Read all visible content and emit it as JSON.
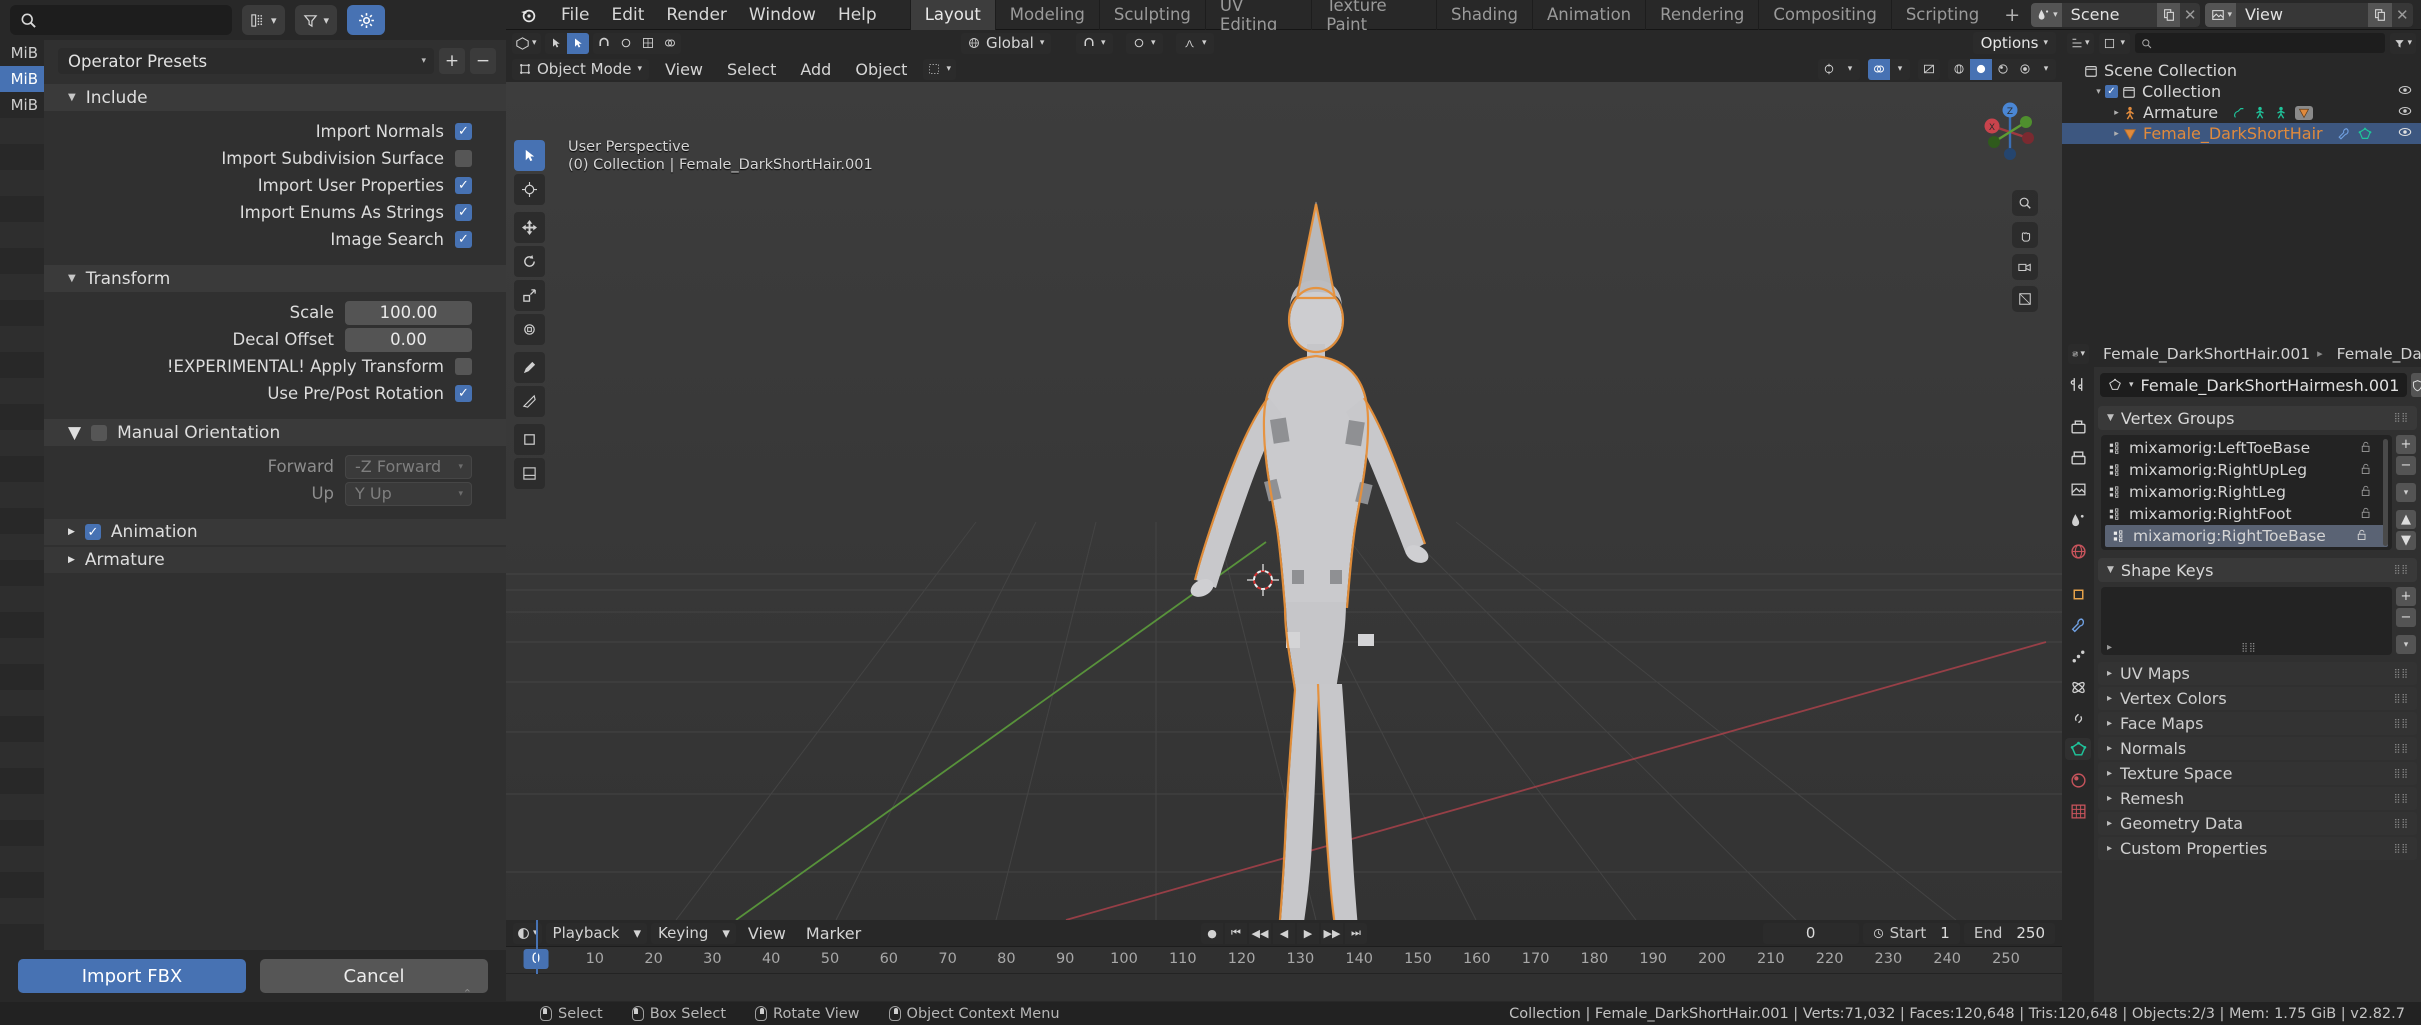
{
  "app": {
    "title": "Blender",
    "version": "v2.82.7"
  },
  "topbar": {
    "menus": [
      "File",
      "Edit",
      "Render",
      "Window",
      "Help"
    ],
    "workspaces": [
      {
        "label": "Layout",
        "active": true
      },
      {
        "label": "Modeling",
        "active": false
      },
      {
        "label": "Sculpting",
        "active": false
      },
      {
        "label": "UV Editing",
        "active": false
      },
      {
        "label": "Texture Paint",
        "active": false
      },
      {
        "label": "Shading",
        "active": false
      },
      {
        "label": "Animation",
        "active": false
      },
      {
        "label": "Rendering",
        "active": false
      },
      {
        "label": "Compositing",
        "active": false
      },
      {
        "label": "Scripting",
        "active": false
      }
    ],
    "add_workspace": "+",
    "scene_name": "Scene",
    "view_layer_name": "View Layer"
  },
  "viewport": {
    "mode": "Object Mode",
    "menus": [
      "View",
      "Select",
      "Add",
      "Object"
    ],
    "transform_orientation": "Global",
    "options_label": "Options",
    "overlay_line1": "User Perspective",
    "overlay_line2": "(0) Collection | Female_DarkShortHair.001",
    "gizmo_axes": [
      "X",
      "Y",
      "Z"
    ]
  },
  "timeline": {
    "menus": [
      "Playback",
      "Keying",
      "View",
      "Marker"
    ],
    "current_frame": "0",
    "start_label": "Start",
    "start_value": "1",
    "end_label": "End",
    "end_value": "250",
    "frame_field": "0",
    "ticks": [
      "0",
      "10",
      "20",
      "30",
      "40",
      "50",
      "60",
      "70",
      "80",
      "90",
      "100",
      "110",
      "120",
      "130",
      "140",
      "150",
      "160",
      "170",
      "180",
      "190",
      "200",
      "210",
      "220",
      "230",
      "240",
      "250"
    ]
  },
  "outliner": {
    "search_placeholder": "",
    "rows": [
      {
        "label": "Scene Collection",
        "indent": 0,
        "type": "scene-collection",
        "selected": false
      },
      {
        "label": "Collection",
        "indent": 1,
        "type": "collection",
        "selected": false
      },
      {
        "label": "Armature",
        "indent": 2,
        "type": "armature",
        "selected": false
      },
      {
        "label": "Female_DarkShortHair",
        "indent": 2,
        "type": "mesh",
        "selected": true
      }
    ]
  },
  "properties": {
    "breadcrumb_object": "Female_DarkShortHair.001",
    "breadcrumb_data": "Female_Da",
    "mesh_datablock": "Female_DarkShortHairmesh.001",
    "vertex_groups_title": "Vertex Groups",
    "vertex_groups": [
      {
        "name": "mixamorig:LeftToeBase",
        "selected": false
      },
      {
        "name": "mixamorig:RightUpLeg",
        "selected": false
      },
      {
        "name": "mixamorig:RightLeg",
        "selected": false
      },
      {
        "name": "mixamorig:RightFoot",
        "selected": false
      },
      {
        "name": "mixamorig:RightToeBase",
        "selected": true
      }
    ],
    "shape_keys_title": "Shape Keys",
    "collapsed_panels": [
      "UV Maps",
      "Vertex Colors",
      "Face Maps",
      "Normals",
      "Texture Space",
      "Remesh",
      "Geometry Data",
      "Custom Properties"
    ]
  },
  "import_dialog": {
    "search_value": "",
    "presets_label": "Operator Presets",
    "add_preset": "+",
    "remove_preset": "−",
    "sidebar_sizes": [
      "MiB",
      "MiB",
      "MiB"
    ],
    "sections": {
      "include": {
        "title": "Include",
        "rows": [
          {
            "label": "Import Normals",
            "checked": true
          },
          {
            "label": "Import Subdivision Surface",
            "checked": false
          },
          {
            "label": "Import User Properties",
            "checked": true
          },
          {
            "label": "Import Enums As Strings",
            "checked": true
          },
          {
            "label": "Image Search",
            "checked": true
          }
        ]
      },
      "transform": {
        "title": "Transform",
        "scale_label": "Scale",
        "scale_value": "100.00",
        "decal_label": "Decal Offset",
        "decal_value": "0.00",
        "apply_transform_label": "!EXPERIMENTAL! Apply Transform",
        "apply_transform_checked": false,
        "prepost_label": "Use Pre/Post Rotation",
        "prepost_checked": true
      },
      "manual_orientation": {
        "title": "Manual Orientation",
        "enabled": false,
        "forward_label": "Forward",
        "forward_value": "-Z Forward",
        "up_label": "Up",
        "up_value": "Y Up"
      },
      "animation": {
        "title": "Animation",
        "checked": true
      },
      "armature": {
        "title": "Armature"
      }
    },
    "confirm_button": "Import FBX",
    "cancel_button": "Cancel"
  },
  "statusbar": {
    "hints": [
      {
        "icon": "mouse-left",
        "label": "Select"
      },
      {
        "icon": "mouse-drag",
        "label": "Box Select"
      },
      {
        "icon": "mouse-middle",
        "label": "Rotate View"
      },
      {
        "icon": "mouse-right",
        "label": "Object Context Menu"
      }
    ],
    "stats": "Collection | Female_DarkShortHair.001 | Verts:71,032 | Faces:120,648 | Tris:120,648 | Objects:2/3 | Mem: 1.75 GiB | v2.82.7"
  },
  "colors": {
    "accent_blue": "#4772b3",
    "outliner_orange": "#e08a3c",
    "mesh_green": "#1fc39a",
    "panel_bg": "#303030",
    "header_bg": "#282828"
  }
}
